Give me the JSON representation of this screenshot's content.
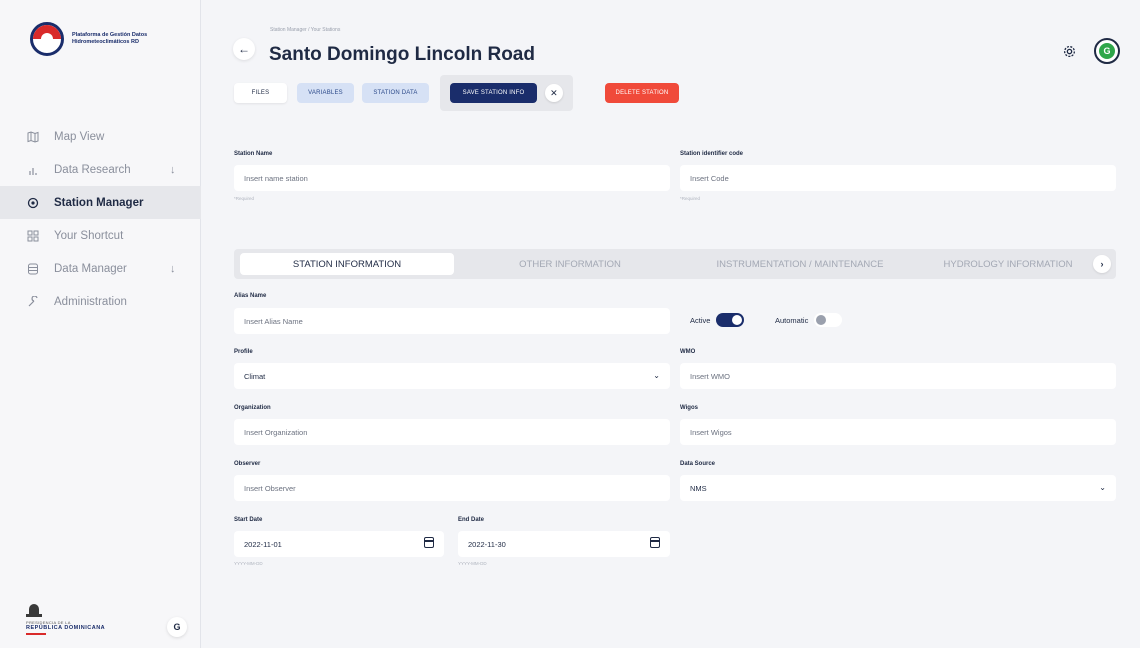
{
  "sidebar": {
    "logo_text": "Plataforma de Gestión Datos Hidrometeoclimáticos RD",
    "items": [
      {
        "label": "Map View",
        "icon": "map-icon",
        "active": false,
        "expandable": false
      },
      {
        "label": "Data Research",
        "icon": "bar-chart-icon",
        "active": false,
        "expandable": true
      },
      {
        "label": "Station Manager",
        "icon": "location-pin-icon",
        "active": true,
        "expandable": false
      },
      {
        "label": "Your Shortcut",
        "icon": "grid-icon",
        "active": false,
        "expandable": false
      },
      {
        "label": "Data Manager",
        "icon": "database-icon",
        "active": false,
        "expandable": true
      },
      {
        "label": "Administration",
        "icon": "wrench-icon",
        "active": false,
        "expandable": false
      }
    ],
    "footer_sub": "PRESIDENCIA DE LA",
    "footer_main": "REPÚBLICA DOMINICANA",
    "theme_glyph": "G"
  },
  "header": {
    "breadcrumb": "Station Manager / Your Stations",
    "title": "Santo Domingo Lincoln Road",
    "avatar_glyph": "G"
  },
  "actions": {
    "files": "FILES",
    "variables": "VARIABLES",
    "station_data": "STATION DATA",
    "save": "SAVE STATION INFO",
    "delete": "DELETE STATION"
  },
  "top_form": {
    "station_name": {
      "label": "Station Name",
      "placeholder": "Insert name station",
      "help": "*Required"
    },
    "station_code": {
      "label": "Station identifier code",
      "placeholder": "Insert Code",
      "help": "*Required"
    }
  },
  "tabs": [
    {
      "label": "STATION INFORMATION",
      "active": true
    },
    {
      "label": "OTHER INFORMATION",
      "active": false
    },
    {
      "label": "INSTRUMENTATION / MAINTENANCE",
      "active": false
    },
    {
      "label": "HYDROLOGY INFORMATION",
      "active": false
    }
  ],
  "form": {
    "alias": {
      "label": "Alias Name",
      "placeholder": "Insert Alias Name"
    },
    "active_label": "Active",
    "active_on": true,
    "automatic_label": "Automatic",
    "automatic_on": false,
    "profile": {
      "label": "Profile",
      "value": "Climat"
    },
    "wmo": {
      "label": "WMO",
      "placeholder": "Insert WMO"
    },
    "organization": {
      "label": "Organization",
      "placeholder": "Insert Organization"
    },
    "wigos": {
      "label": "Wigos",
      "placeholder": "Insert Wigos"
    },
    "observer": {
      "label": "Observer",
      "placeholder": "Insert Observer"
    },
    "data_source": {
      "label": "Data Source",
      "value": "NMS"
    },
    "start_date": {
      "label": "Start Date",
      "value": "2022-11-01",
      "help": "YYYY-MM-DD"
    },
    "end_date": {
      "label": "End Date",
      "value": "2022-11-30",
      "help": "YYYY-MM-DD"
    }
  },
  "colors": {
    "primary": "#1a2d6b",
    "danger": "#f04a3a",
    "accent_light": "#d6e1f5",
    "brand_red": "#d92a2a",
    "brand_green": "#2fa64a"
  }
}
